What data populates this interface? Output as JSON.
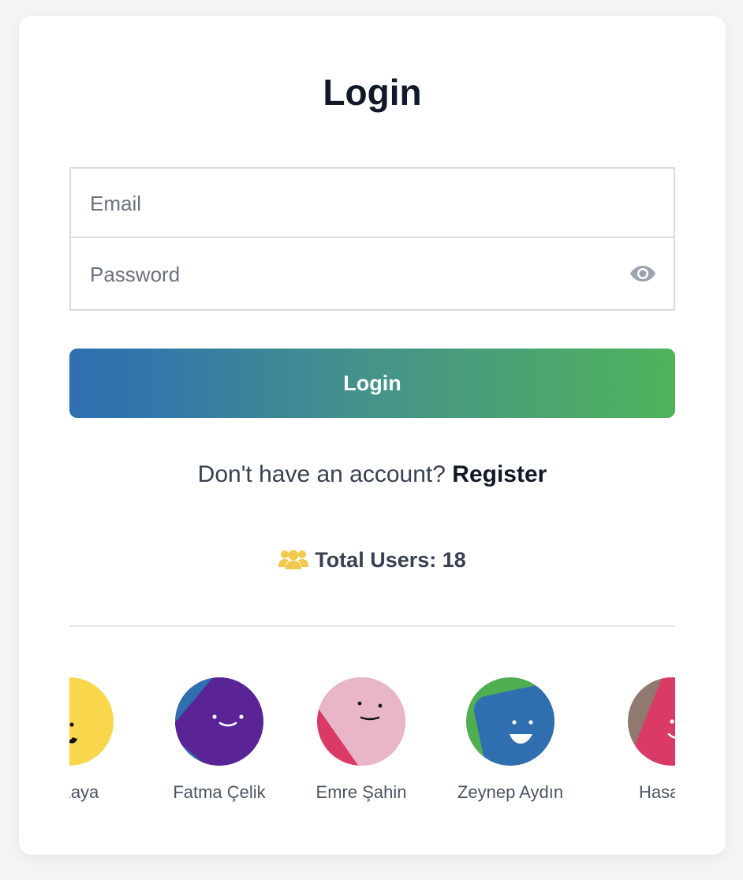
{
  "login": {
    "title": "Login",
    "email_placeholder": "Email",
    "password_placeholder": "Password",
    "button_label": "Login",
    "register_prompt": "Don't have an account?",
    "register_link": "Register",
    "total_users_text": "Total Users: 18",
    "users_icon": "users-icon",
    "password_toggle_icon": "eye-icon"
  },
  "carousel": {
    "users": [
      {
        "name": "et Kaya",
        "avatar_colors": [
          "#f8d74d"
        ]
      },
      {
        "name": "Fatma Çelik",
        "avatar_colors": [
          "#2f6faf",
          "#5a2396"
        ]
      },
      {
        "name": "Emre Şahin",
        "avatar_colors": [
          "#d93b66",
          "#e8b6c8"
        ]
      },
      {
        "name": "Zeynep Aydın",
        "avatar_colors": [
          "#4fad52",
          "#2f6faf"
        ]
      },
      {
        "name": "Hasan Y",
        "avatar_colors": [
          "#907a70",
          "#d93b66"
        ]
      }
    ]
  },
  "colors": {
    "button_gradient_start": "#2f6faf",
    "button_gradient_end": "#4fb35a",
    "users_icon": "#f2c94c"
  }
}
